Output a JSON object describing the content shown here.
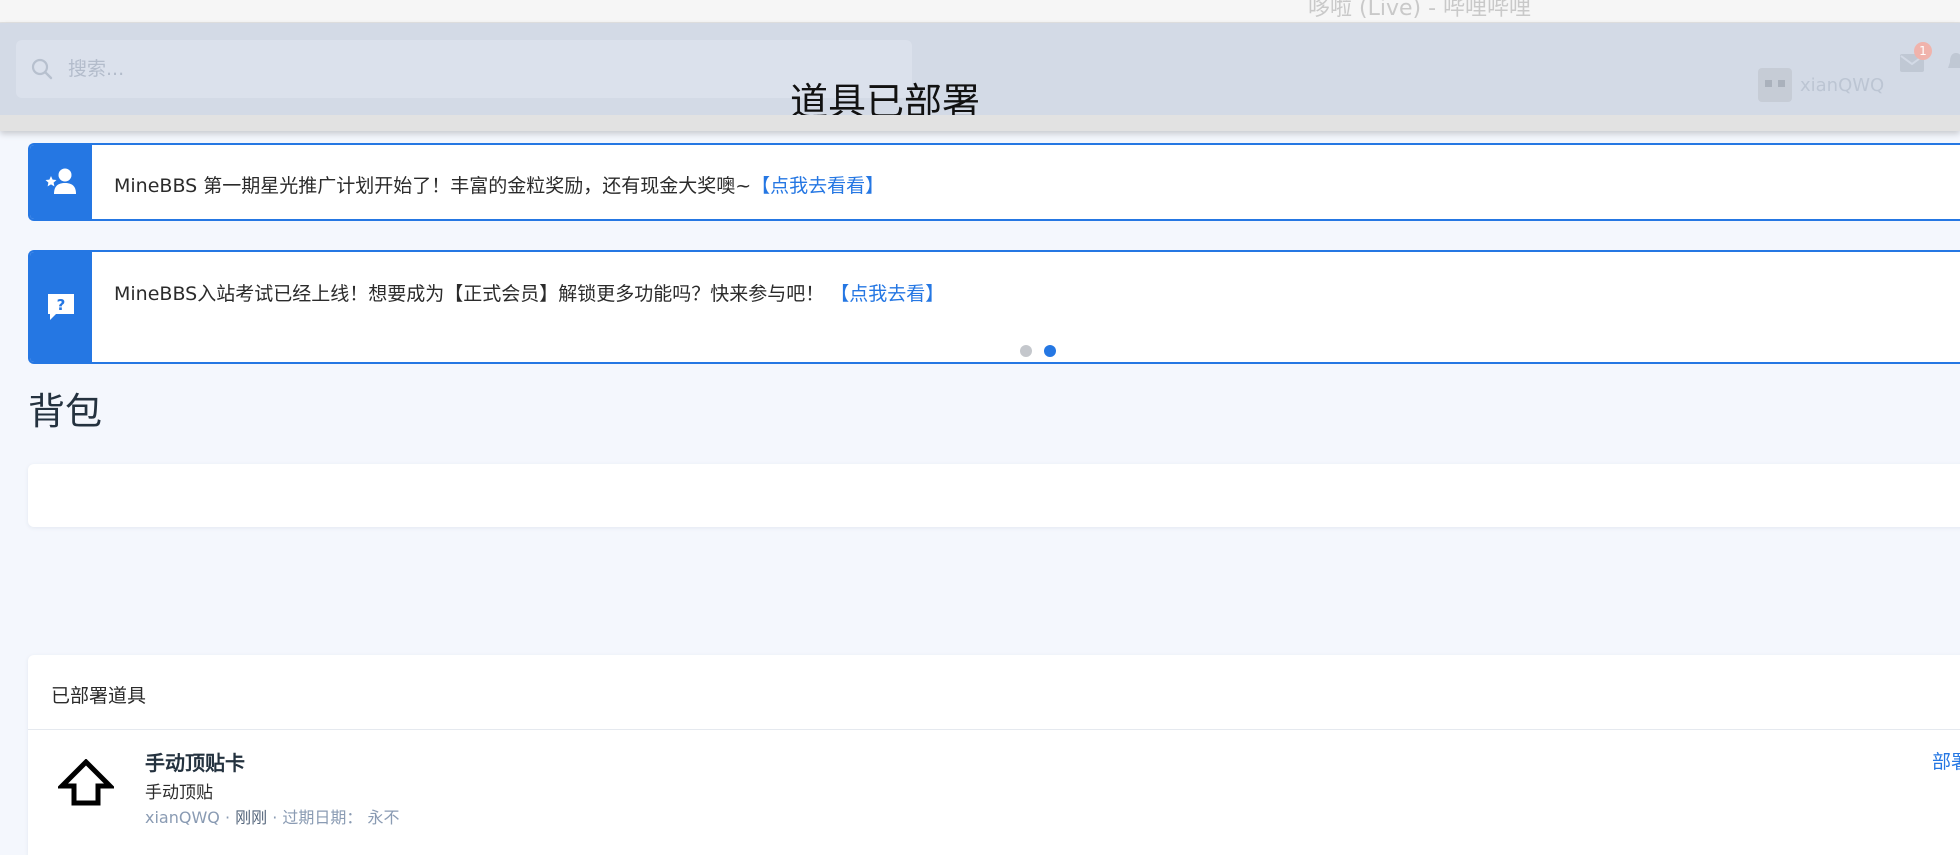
{
  "window": {
    "ghost_title": "哆啦 (Live) - 哔哩哔哩"
  },
  "header": {
    "search_placeholder": "搜索...",
    "toast": "道具已部署",
    "username": "xianQWQ",
    "mail_badge": "1"
  },
  "notices": [
    {
      "icon": "user-star-icon",
      "text": "MineBBS 第一期星光推广计划开始了！丰富的金粒奖励，还有现金大奖噢~",
      "link": "【点我去看看】"
    },
    {
      "icon": "help-chat-icon",
      "text": "MineBBS入站考试已经上线！想要成为【正式会员】解锁更多功能吗？快来参与吧！",
      "link": "【点我去看】"
    }
  ],
  "pager": {
    "total": 2,
    "active": 2
  },
  "backpack": {
    "title": "背包"
  },
  "deployed": {
    "title": "已部署道具",
    "items": [
      {
        "icon": "arrow-up-outline-icon",
        "name": "手动顶贴卡",
        "desc": "手动顶贴",
        "user": "xianQWQ",
        "sep1": " · ",
        "time": "刚刚",
        "sep2": " · ",
        "expiry_label": "过期日期：",
        "expiry_value": "永不",
        "action": "部署"
      }
    ]
  },
  "colors": {
    "accent": "#2577e3",
    "page_bg": "#f4f7fd",
    "header_bg": "#d3dae6"
  }
}
